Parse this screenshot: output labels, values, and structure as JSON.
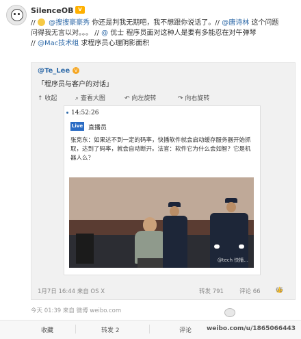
{
  "post": {
    "username": "SilenceOB",
    "badge": "V",
    "line1_prefix": "//",
    "mention1": "@搜搜豪豪秀",
    "line1_text": "你还是判我无期吧，我不想跟你说话了。//",
    "mention2": "@唐诗林",
    "line1_tail": "这个问题",
    "line2": "问得我无言以对。。。 //",
    "mention3": "@",
    "mention3b": "优士",
    "line2_tail": "程序员面对这种人是要有多能忍在对午弹琴",
    "line3_prefix": "//",
    "mention4": "@Mac技术组",
    "line3_tail": "求程序员心理阴影面积"
  },
  "quote": {
    "username": "@Te_Lee",
    "vbadge": "V",
    "text": "「程序员与客户的对话」",
    "toolbar": {
      "collapse": "收起",
      "view_large": "查看大图",
      "rotate_left": "向左旋转",
      "rotate_right": "向右旋转"
    },
    "image": {
      "time": "14:52:26",
      "live_badge": "Live",
      "live_label": "直播员",
      "speech": "张克东：如果达不到一定的码率，快播软件就会启动缓存服务器开始抓取，达到了码率，就会自动断开。法官：软件它为什么会如智？它是机器人么？",
      "watermark": "@tech 快播..."
    },
    "footer": {
      "date": "1月7日 16:44 来自 OS X",
      "repost": "转发 791",
      "comment": "评论 66",
      "like": "66"
    }
  },
  "meta": "今天 01:39 来自 微博 weibo.com",
  "bottom": {
    "collect": "收藏",
    "repost": "转发 2",
    "comment": "评论",
    "brand": "weibo.com/u/1865066443"
  }
}
